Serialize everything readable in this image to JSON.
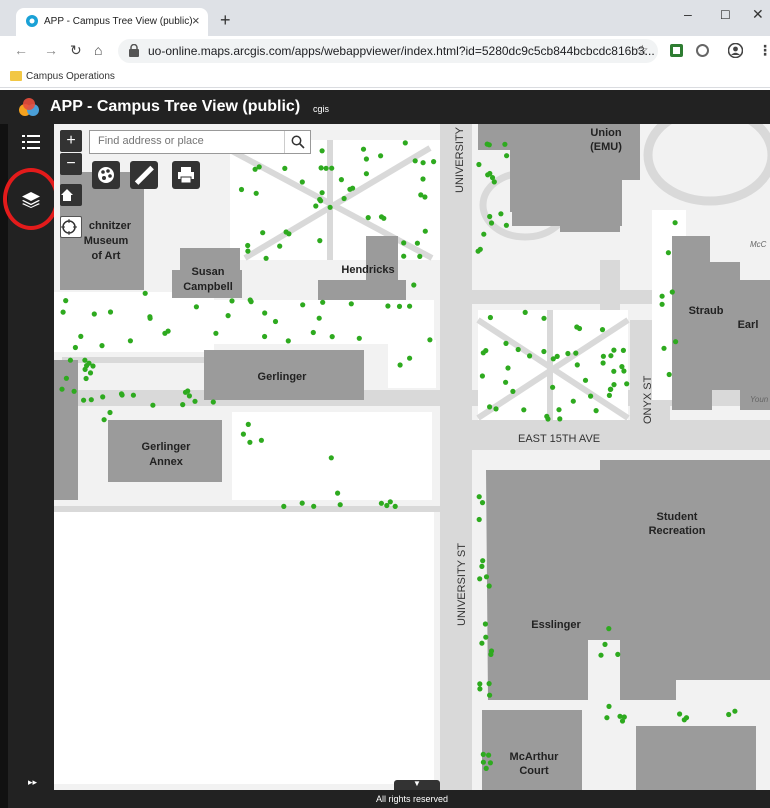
{
  "browser": {
    "tab_title": "APP - Campus Tree View (public)",
    "tab_close": "×",
    "new_tab": "+",
    "url": "uo-online.maps.arcgis.com/apps/webappviewer/index.html?id=5280dc9c5cb844bcbcdc816b3...",
    "bookmark": "Campus Operations",
    "win_min": "–",
    "win_max": "☐",
    "win_close": "✕"
  },
  "app": {
    "title": "APP - Campus Tree View (public)",
    "subtitle": "cgis"
  },
  "search": {
    "placeholder": "Find address or place"
  },
  "zoom": {
    "in": "+",
    "out": "−"
  },
  "footer": {
    "text": "All rights reserved"
  },
  "map_labels": {
    "union": "Union",
    "emu": "(EMU)",
    "schnitzer1": "chnitzer",
    "schnitzer2": "Museum",
    "schnitzer3": "of Art",
    "susan1": "Susan",
    "susan2": "Campbell",
    "hendricks": "Hendricks",
    "straub": "Straub",
    "earl": "Earl",
    "gerlinger": "Gerlinger",
    "annex1": "Gerlinger",
    "annex2": "Annex",
    "east15": "EAST 15TH AVE",
    "onyx": "ONYX ST",
    "university_top": "UNIVERSITY",
    "university_st": "UNIVERSITY ST",
    "studentrec1": "Student",
    "studentrec2": "Recreation",
    "esslinger": "Esslinger",
    "mcarthur1": "McArthur",
    "mcarthur2": "Court",
    "mcc": "McC",
    "youn": "Youn"
  },
  "colors": {
    "tree": "#2eaa1f",
    "building": "#9b9b9b",
    "road": "#d9d9d9",
    "header": "#222222",
    "highlight": "#e31b1b"
  }
}
